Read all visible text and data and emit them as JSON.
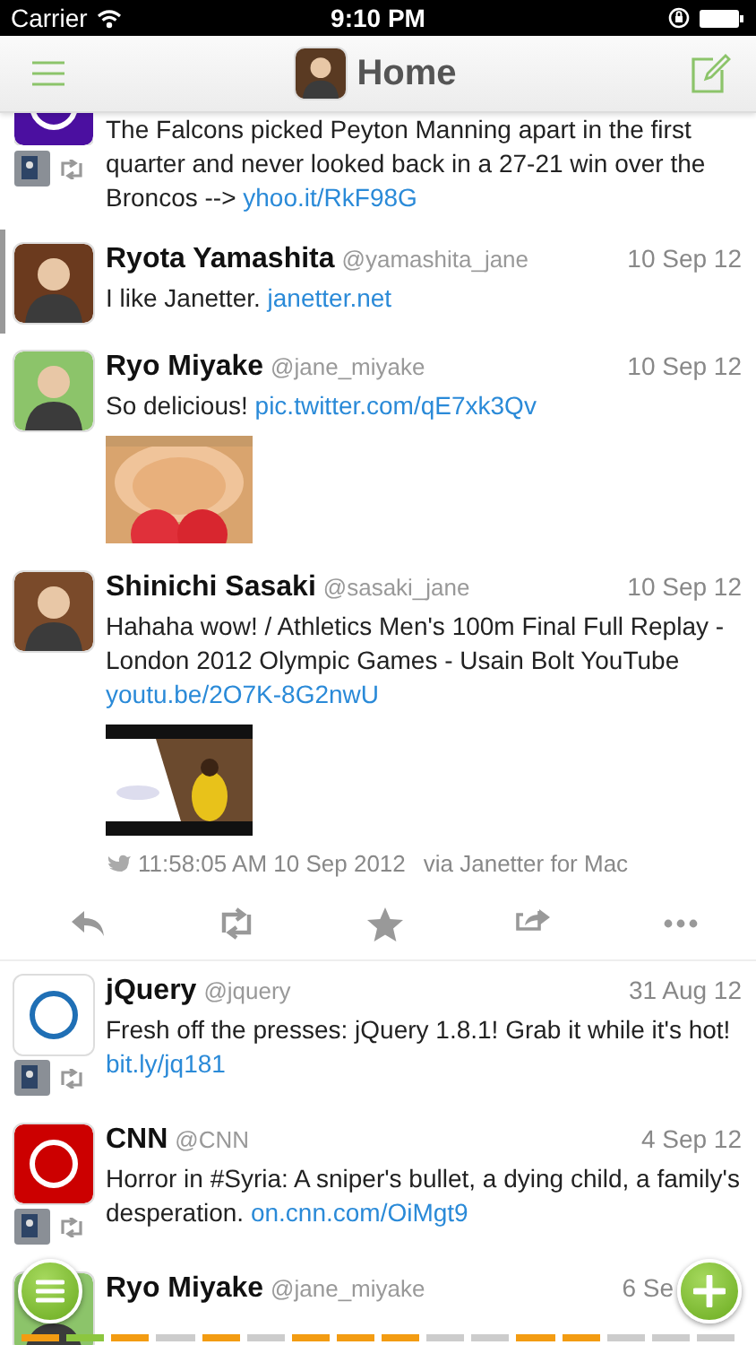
{
  "status_bar": {
    "carrier": "Carrier",
    "time": "9:10 PM"
  },
  "header": {
    "title": "Home"
  },
  "tweets": [
    {
      "text": "The Falcons picked Peyton Manning apart in the first quarter and never looked back in a 27-21 win over the Broncos -->",
      "link": "yhoo.it/RkF98G",
      "avatar": {
        "kind": "logo",
        "color": "#4b0fa0"
      },
      "retweeted": true,
      "marked": false
    },
    {
      "name": "Ryota Yamashita",
      "handle": "@yamashita_jane",
      "date": "10 Sep 12",
      "text": "I like Janetter.",
      "link": "janetter.net",
      "avatar": {
        "kind": "person",
        "color": "#6b3a1e"
      },
      "retweeted": false,
      "marked": true
    },
    {
      "name": "Ryo Miyake",
      "handle": "@jane_miyake",
      "date": "10 Sep 12",
      "text": "So delicious!",
      "link": "pic.twitter.com/qE7xk3Qv",
      "avatar": {
        "kind": "person",
        "color": "#8cc46a"
      },
      "retweeted": false,
      "marked": false
    },
    {
      "name": "Shinichi Sasaki",
      "handle": "@sasaki_jane",
      "date": "10 Sep 12",
      "text": "Hahaha wow! / Athletics Men's 100m Final Full Replay - London 2012 Olympic Games - Usain Bolt YouTube",
      "link": "youtu.be/2O7K-8G2nwU",
      "avatar": {
        "kind": "person",
        "color": "#7a4a2a"
      },
      "media": {
        "kind": "video"
      },
      "retweeted": false,
      "marked": false,
      "expanded": true,
      "detail": {
        "time": "11:58:05 AM 10 Sep 2012",
        "source": "via Janetter for Mac"
      }
    },
    {
      "name": "jQuery",
      "handle": "@jquery",
      "date": "31 Aug 12",
      "text": "Fresh off the presses: jQuery 1.8.1! Grab it while it's hot!",
      "link": "bit.ly/jq181",
      "avatar": {
        "kind": "logo",
        "color": "#ffffff"
      },
      "retweeted": true,
      "marked": false
    },
    {
      "name": "CNN",
      "handle": "@CNN",
      "date": "4 Sep 12",
      "text": "Horror in #Syria: A sniper's bullet, a dying child, a family's desperation.",
      "link": "on.cnn.com/OiMgt9",
      "avatar": {
        "kind": "logo",
        "color": "#cc0000"
      },
      "retweeted": true,
      "marked": false
    },
    {
      "name": "Ryo Miyake",
      "handle": "@jane_miyake",
      "date": "6 Se",
      "avatar": {
        "kind": "person",
        "color": "#8cc46a"
      },
      "retweeted": false,
      "marked": false
    }
  ],
  "pages": [
    {
      "color": "#f39c12"
    },
    {
      "color": "#8cc63f"
    },
    {
      "color": "#f39c12"
    },
    {
      "color": "#cccccc"
    },
    {
      "color": "#f39c12"
    },
    {
      "color": "#cccccc"
    },
    {
      "color": "#f39c12"
    },
    {
      "color": "#f39c12"
    },
    {
      "color": "#f39c12"
    },
    {
      "color": "#cccccc"
    },
    {
      "color": "#cccccc"
    },
    {
      "color": "#f39c12"
    },
    {
      "color": "#f39c12"
    },
    {
      "color": "#cccccc"
    },
    {
      "color": "#cccccc"
    },
    {
      "color": "#cccccc"
    }
  ]
}
